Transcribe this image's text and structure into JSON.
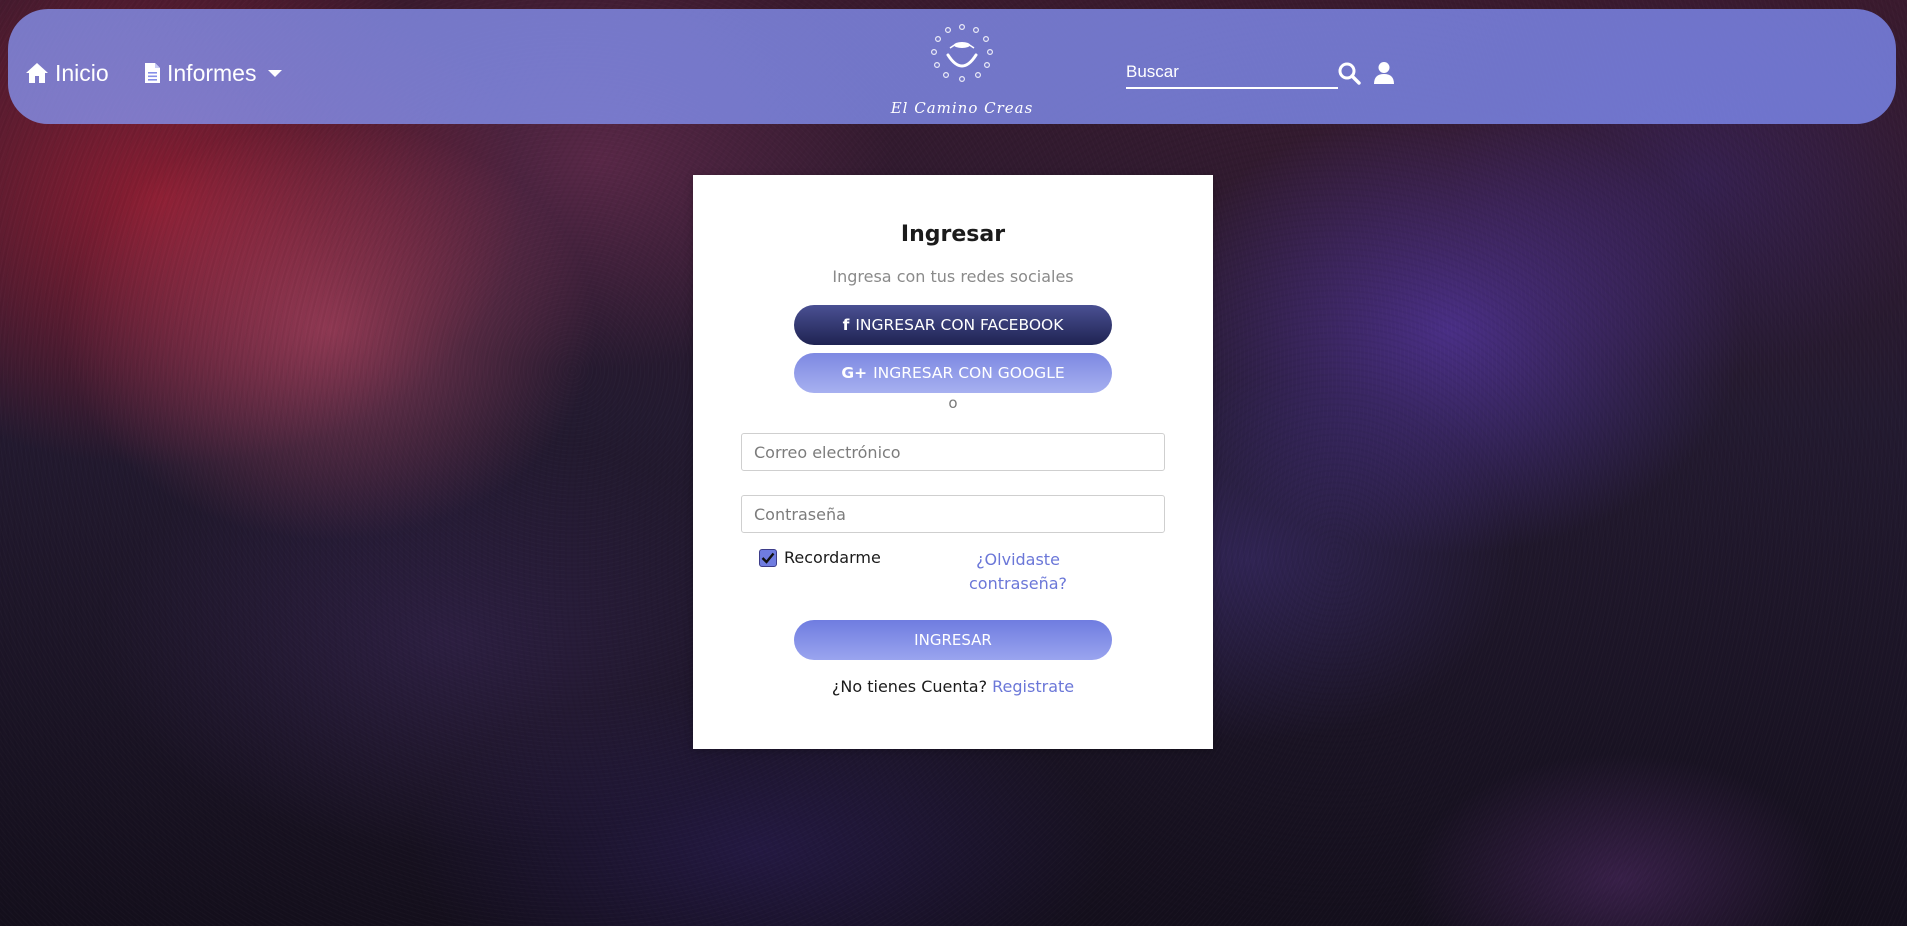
{
  "navbar": {
    "home_label": "Inicio",
    "reports_label": "Informes",
    "logo_text": "El Camino Creas",
    "search": {
      "placeholder": "Buscar",
      "value": ""
    }
  },
  "login": {
    "title": "Ingresar",
    "subtitle": "Ingresa con tus redes sociales",
    "facebook_button": "INGRESAR CON FACEBOOK",
    "facebook_icon": "f",
    "google_button": "INGRESAR CON GOOGLE",
    "google_icon": "G+",
    "or_text": "o",
    "email_placeholder": "Correo electrónico",
    "email_value": "",
    "password_placeholder": "Contraseña",
    "password_value": "",
    "remember_label": "Recordarme",
    "remember_checked": true,
    "forgot_label": "¿Olvidaste contraseña?",
    "submit_label": "INGRESAR",
    "no_account_text": "¿No tienes Cuenta?",
    "register_label": "Registrate"
  },
  "colors": {
    "navbar": "#8690e8",
    "primary": "#6f7ce0",
    "facebook": "#2a2f66",
    "link": "#6b77d8"
  }
}
